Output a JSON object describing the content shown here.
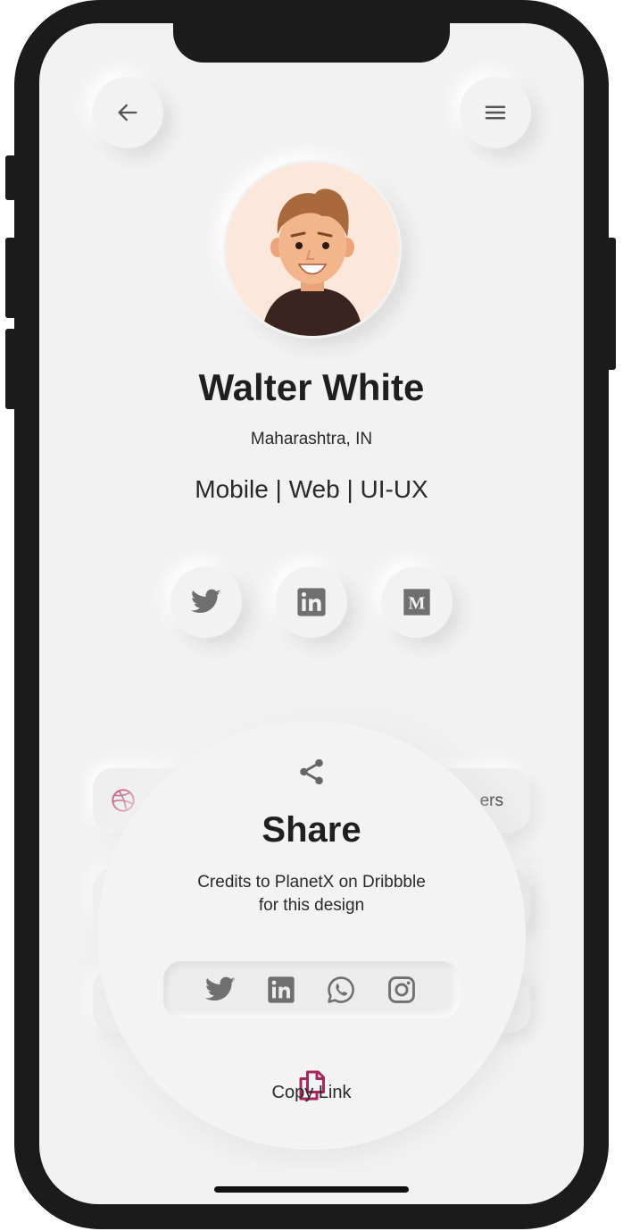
{
  "profile": {
    "name": "Walter White",
    "location": "Maharashtra, IN",
    "role": "Mobile | Web | UI-UX"
  },
  "header": {
    "back_icon": "arrow-left-icon",
    "menu_icon": "hamburger-menu-icon"
  },
  "socials": [
    "twitter-icon",
    "linkedin-icon",
    "medium-icon"
  ],
  "background_card": {
    "partial_text": "ers",
    "icon": "dribbble-icon"
  },
  "share": {
    "title": "Share",
    "credits_line1": "Credits to PlanetX on Dribbble",
    "credits_line2": "for this design",
    "targets": [
      "twitter-icon",
      "linkedin-icon",
      "whatsapp-icon",
      "instagram-icon"
    ],
    "copy_label": "Copy Link"
  },
  "colors": {
    "background": "#f2f2f2",
    "text": "#1f1f1f",
    "icon_gray": "#6f6f6f",
    "accent": "#a8265c",
    "frame": "#1b1b1b"
  }
}
